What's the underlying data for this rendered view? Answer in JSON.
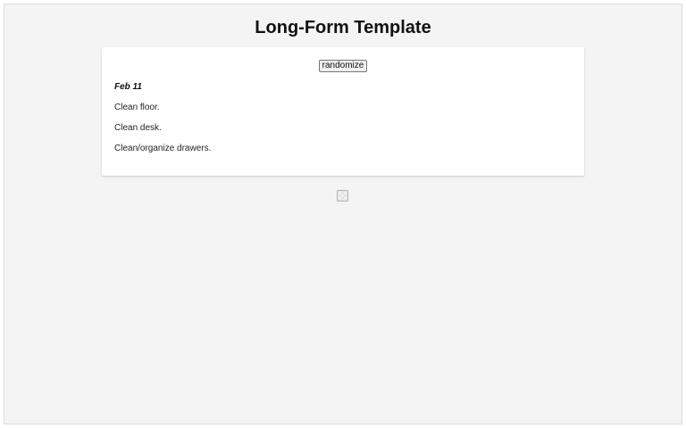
{
  "page": {
    "title": "Long-Form Template"
  },
  "card": {
    "randomize_label": "randomize",
    "date": "Feb 11",
    "lines": [
      "Clean floor.",
      "Clean desk.",
      "Clean/organize drawers."
    ]
  },
  "icons": {
    "dice": "dice-icon"
  },
  "colors": {
    "background": "#f4f4f4",
    "card": "#ffffff",
    "text": "#111111"
  }
}
